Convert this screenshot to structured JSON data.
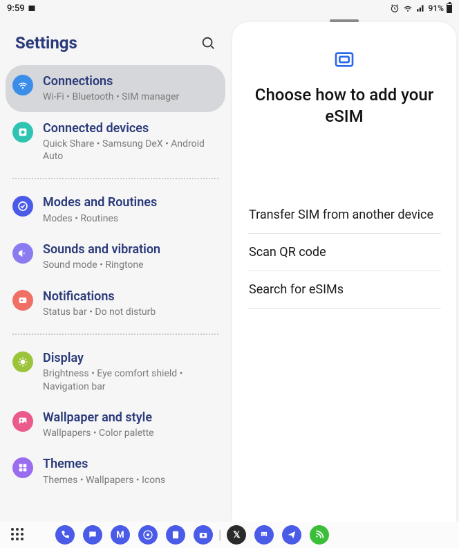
{
  "status": {
    "time": "9:59",
    "battery": "91%"
  },
  "settings": {
    "title": "Settings",
    "items": [
      {
        "label": "Connections",
        "sub": "Wi-Fi  •  Bluetooth  •  SIM manager",
        "iconBg": "#3a8eea",
        "selected": true
      },
      {
        "label": "Connected devices",
        "sub": "Quick Share  •  Samsung DeX  •  Android Auto",
        "iconBg": "#2fc4b1"
      },
      {
        "label": "Modes and Routines",
        "sub": "Modes  •  Routines",
        "iconBg": "#4a5be8"
      },
      {
        "label": "Sounds and vibration",
        "sub": "Sound mode  •  Ringtone",
        "iconBg": "#8a7cf0"
      },
      {
        "label": "Notifications",
        "sub": "Status bar  •  Do not disturb",
        "iconBg": "#f07066"
      },
      {
        "label": "Display",
        "sub": "Brightness  •  Eye comfort shield  •  Navigation bar",
        "iconBg": "#9cc43a"
      },
      {
        "label": "Wallpaper and style",
        "sub": "Wallpapers  •  Color palette",
        "iconBg": "#ea5a8a"
      },
      {
        "label": "Themes",
        "sub": "Themes  •  Wallpapers  •  Icons",
        "iconBg": "#9a6cf0"
      }
    ]
  },
  "panel": {
    "title": "Choose how to add your eSIM",
    "options": [
      "Transfer SIM from another device",
      "Scan QR code",
      "Search for eSIMs"
    ]
  },
  "navApps": [
    {
      "bg": "#4a5be8",
      "glyph": "phone"
    },
    {
      "bg": "#4a5be8",
      "glyph": "chat"
    },
    {
      "bg": "#4a5be8",
      "glyph": "M"
    },
    {
      "bg": "#4a5be8",
      "glyph": "chrome"
    },
    {
      "bg": "#4a5be8",
      "glyph": "note"
    },
    {
      "bg": "#4a5be8",
      "glyph": "cam"
    },
    {
      "bg": "#2a2a2a",
      "glyph": "X"
    },
    {
      "bg": "#4a5be8",
      "glyph": "discord"
    },
    {
      "bg": "#4a5be8",
      "glyph": "send"
    },
    {
      "bg": "#3bbf3b",
      "glyph": "feed"
    }
  ]
}
